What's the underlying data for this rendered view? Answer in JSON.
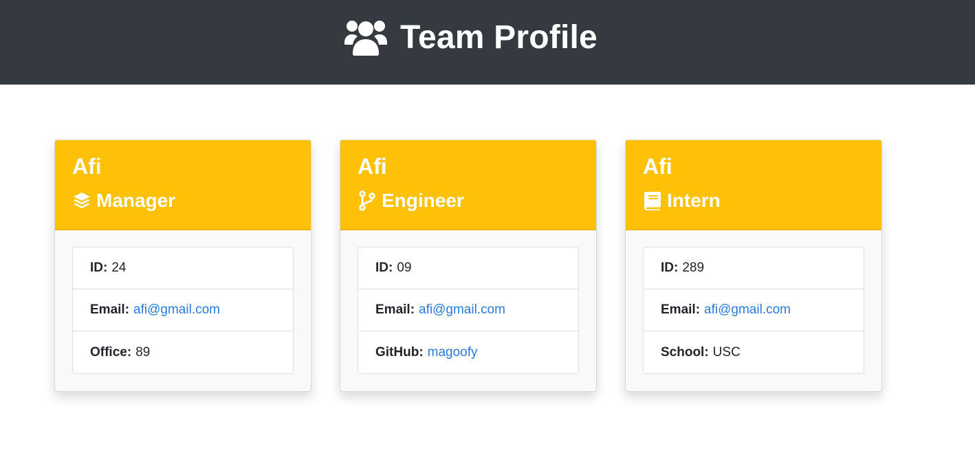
{
  "header": {
    "title": "Team Profile",
    "icon": "users-icon"
  },
  "colors": {
    "header_bg": "#343a40",
    "card_head_bg": "#ffc107",
    "card_body_bg": "#f8f9fa",
    "link": "#2a7ad5"
  },
  "cards": [
    {
      "name": "Afi",
      "role": "Manager",
      "role_icon": "layer-group-icon",
      "id_label": "ID:",
      "id_value": "24",
      "email_label": "Email:",
      "email_value": "afi@gmail.com",
      "extra_label": "Office:",
      "extra_value": "89"
    },
    {
      "name": "Afi",
      "role": "Engineer",
      "role_icon": "code-branch-icon",
      "id_label": "ID:",
      "id_value": "09",
      "email_label": "Email:",
      "email_value": "afi@gmail.com",
      "extra_label": "GitHub:",
      "extra_value": "magoofy"
    },
    {
      "name": "Afi",
      "role": "Intern",
      "role_icon": "book-icon",
      "id_label": "ID:",
      "id_value": "289",
      "email_label": "Email:",
      "email_value": "afi@gmail.com",
      "extra_label": "School:",
      "extra_value": "USC"
    }
  ]
}
